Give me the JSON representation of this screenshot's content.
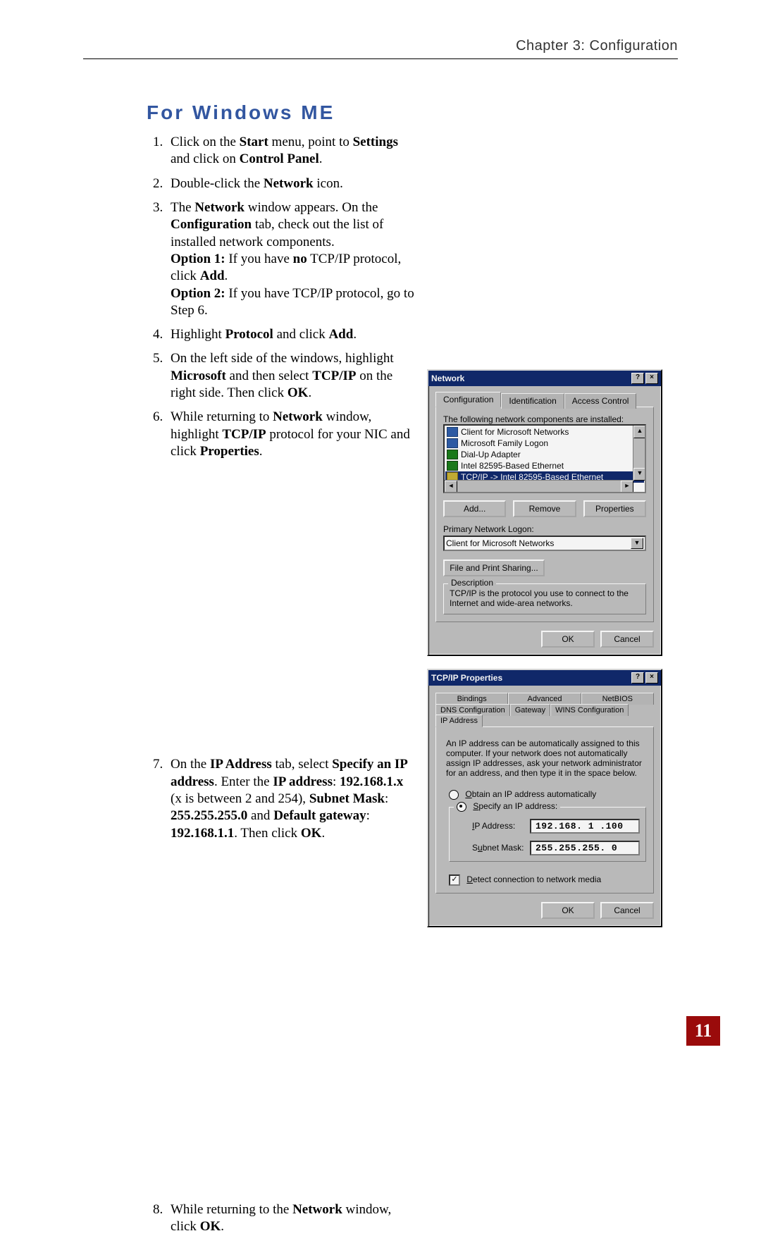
{
  "header": {
    "running_head": "Chapter 3: Configuration"
  },
  "section": {
    "title": "For Windows ME"
  },
  "steps": {
    "s1_a": "Click on the ",
    "s1_b": "Start",
    "s1_c": " menu, point to ",
    "s1_d": "Settings",
    "s1_e": " and click on ",
    "s1_f": "Control Panel",
    "s1_g": ".",
    "s2_a": "Double-click the ",
    "s2_b": "Network",
    "s2_c": " icon.",
    "s3_a": "The ",
    "s3_b": "Network",
    "s3_c": " window appears. On the ",
    "s3_d": "Configuration",
    "s3_e": " tab, check out the list of installed network components.",
    "s3_f": "Option 1:",
    "s3_g": " If you have ",
    "s3_h": "no",
    "s3_i": " TCP/IP protocol, click ",
    "s3_j": "Add",
    "s3_k": ".",
    "s3_l": "Option 2:",
    "s3_m": " If you have TCP/IP protocol, go to Step 6.",
    "s4_a": "Highlight ",
    "s4_b": "Protocol",
    "s4_c": " and click ",
    "s4_d": "Add",
    "s4_e": ".",
    "s5_a": "On the left side of the windows, highlight ",
    "s5_b": "Microsoft",
    "s5_c": " and then select ",
    "s5_d": "TCP/IP",
    "s5_e": " on the right side. Then click ",
    "s5_f": "OK",
    "s5_g": ".",
    "s6_a": "While returning to ",
    "s6_b": "Network",
    "s6_c": " window, highlight ",
    "s6_d": "TCP/IP",
    "s6_e": " protocol for your NIC and click ",
    "s6_f": "Properties",
    "s6_g": ".",
    "s7_a": "On the ",
    "s7_b": "IP Address",
    "s7_c": " tab, select ",
    "s7_d": "Specify an IP address",
    "s7_e": ". Enter the ",
    "s7_f": "IP address",
    "s7_g": ": ",
    "s7_h": "192.168.1.x",
    "s7_i": " (x is between 2 and 254), ",
    "s7_j": "Subnet Mask",
    "s7_k": ": ",
    "s7_l": "255.255.255.0",
    "s7_m": " and ",
    "s7_n": "Default gateway",
    "s7_o": ": ",
    "s7_p": "192.168.1.1",
    "s7_q": ". Then click ",
    "s7_r": "OK",
    "s7_s": ".",
    "s8_a": "While returning to the ",
    "s8_b": "Network",
    "s8_c": " window, click ",
    "s8_d": "OK",
    "s8_e": "."
  },
  "shot_network": {
    "title": "Network",
    "help_btn": "?",
    "close_btn": "×",
    "tabs": {
      "t0": "Configuration",
      "t1": "Identification",
      "t2": "Access Control"
    },
    "list_label": "The following network components are installed:",
    "items": {
      "i0": "Client for Microsoft Networks",
      "i1": "Microsoft Family Logon",
      "i2": "Dial-Up Adapter",
      "i3": "Intel 82595-Based Ethernet",
      "i4": "TCP/IP -> Intel 82595-Based Ethernet"
    },
    "btn_add": "Add...",
    "btn_remove": "Remove",
    "btn_props": "Properties",
    "primary_label": "Primary Network Logon:",
    "primary_value": "Client for Microsoft Networks",
    "file_print": "File and Print Sharing...",
    "desc_label": "Description",
    "desc_text": "TCP/IP is the protocol you use to connect to the Internet and wide-area networks.",
    "ok": "OK",
    "cancel": "Cancel"
  },
  "shot_tcpip": {
    "title": "TCP/IP Properties",
    "help_btn": "?",
    "close_btn": "×",
    "tabs_top": {
      "t0": "Bindings",
      "t1": "Advanced",
      "t2": "NetBIOS"
    },
    "tabs_bot": {
      "t0": "DNS Configuration",
      "t1": "Gateway",
      "t2": "WINS Configuration",
      "t3": "IP Address"
    },
    "desc": "An IP address can be automatically assigned to this computer. If your network does not automatically assign IP addresses, ask your network administrator for an address, and then type it in the space below.",
    "opt_obtain_pre": "O",
    "opt_obtain": "btain an IP address automatically",
    "opt_specify_pre": "S",
    "opt_specify": "pecify an IP address:",
    "ip_label_pre": "I",
    "ip_label": "P Address:",
    "ip_value": "192.168. 1 .100",
    "mask_label_pre": "u",
    "mask_label_a": "S",
    "mask_label_b": "bnet Mask:",
    "mask_value": "255.255.255. 0",
    "detect_pre": "D",
    "detect": "etect connection to network media",
    "ok": "OK",
    "cancel": "Cancel"
  },
  "page_number": "11"
}
